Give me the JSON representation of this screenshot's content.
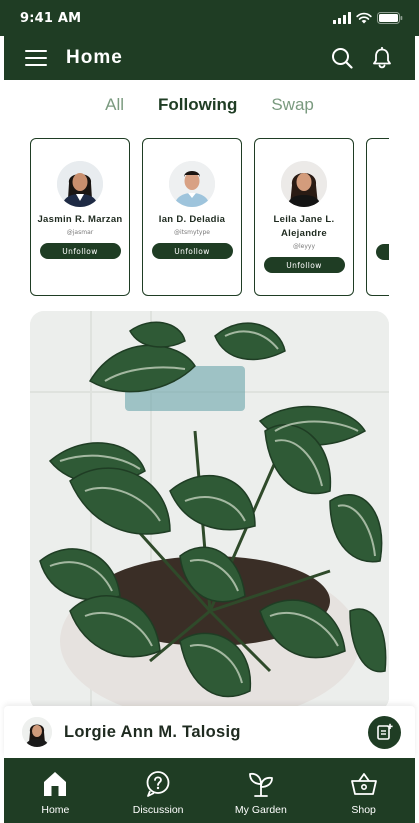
{
  "status_bar": {
    "time": "9:41 AM"
  },
  "header": {
    "title": "Home",
    "icons": [
      "menu-icon",
      "search-icon",
      "bell-icon"
    ]
  },
  "tabs": [
    {
      "label": "All",
      "active": false
    },
    {
      "label": "Following",
      "active": true
    },
    {
      "label": "Swap",
      "active": false
    }
  ],
  "suggestions": [
    {
      "name": "Jasmin R. Marzan",
      "handle": "@jasmar",
      "button": "Unfollow"
    },
    {
      "name": "Ian D. Deladia",
      "handle": "@itsmytype",
      "button": "Unfollow"
    },
    {
      "name": "Leila Jane L. Alejandre",
      "handle": "@leyyy",
      "button": "Unfollow"
    }
  ],
  "post": {
    "image_alt": "leafy potted plant",
    "author": "Lorgie Ann M. Talosig",
    "add_icon": "add-post-icon"
  },
  "bottom_nav": [
    {
      "label": "Home",
      "icon": "home-icon"
    },
    {
      "label": "Discussion",
      "icon": "chat-icon"
    },
    {
      "label": "My Garden",
      "icon": "sprout-icon"
    },
    {
      "label": "Shop",
      "icon": "basket-icon"
    }
  ],
  "colors": {
    "primary": "#1f3d24",
    "tab_inactive": "#7a9a7f",
    "surface": "#ffffff"
  }
}
